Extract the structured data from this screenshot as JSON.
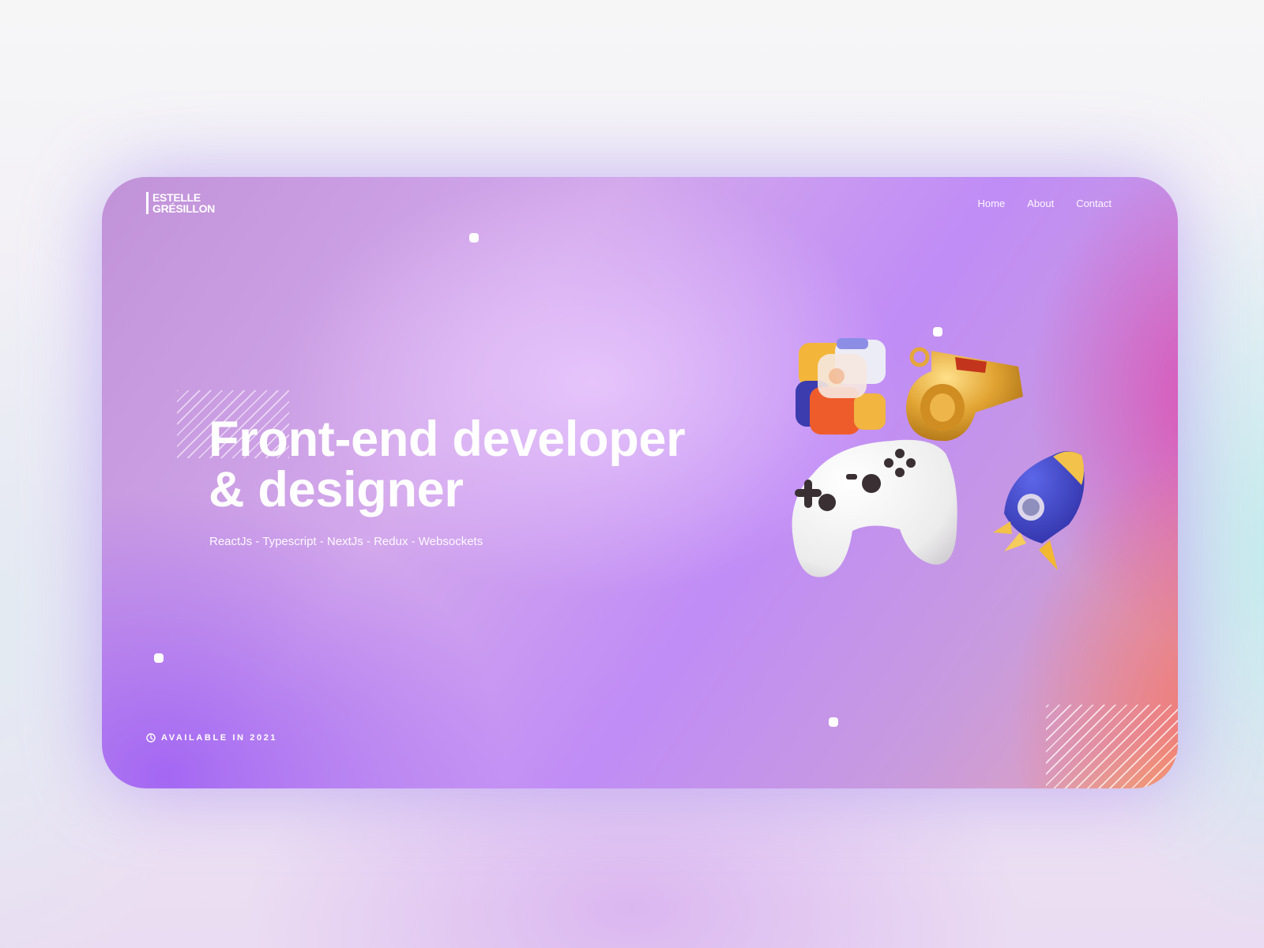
{
  "brand": {
    "line1": "ESTELLE",
    "line2": "GRÉSILLON"
  },
  "nav": {
    "items": [
      "Home",
      "About",
      "Contact"
    ]
  },
  "hero": {
    "headline_line1": "Front-end developer",
    "headline_line2": "& designer",
    "subtitle": "ReactJs - Typescript - NextJs - Redux - Websockets"
  },
  "footer": {
    "availability": "AVAILABLE IN 2021",
    "availability_icon": "clock-icon"
  },
  "illustration": {
    "objects": [
      "cube-icon",
      "whistle-icon",
      "gamepad-icon",
      "rocket-icon"
    ]
  },
  "colors": {
    "accent_pink": "#de3ca8",
    "accent_yellow": "#ffec28",
    "accent_purple": "#9e60f4",
    "text": "#ffffff"
  }
}
